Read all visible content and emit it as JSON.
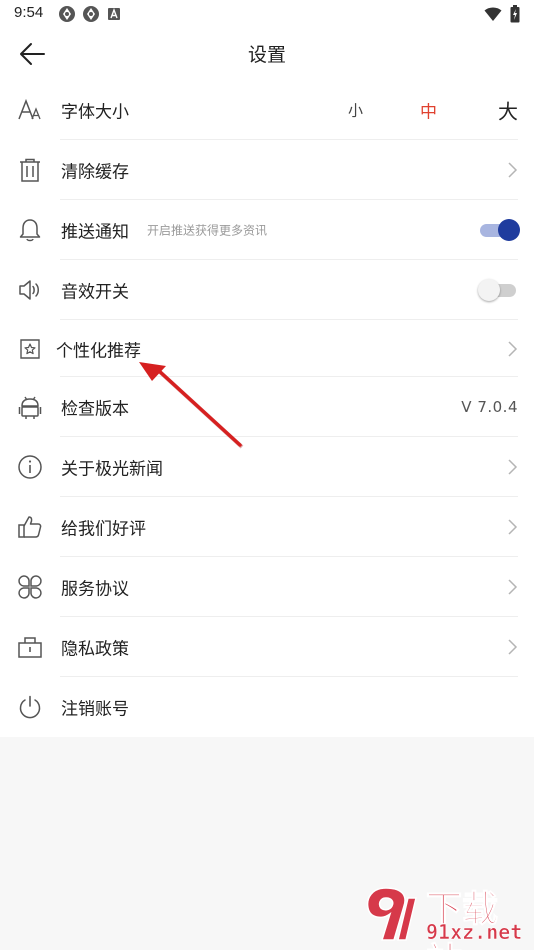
{
  "status_bar": {
    "time": "9:54",
    "left_icons": [
      "app-notification-icon",
      "app-notification-icon",
      "a-notification-icon"
    ],
    "right_icons": [
      "wifi-icon",
      "battery-charging-icon"
    ]
  },
  "header": {
    "title": "设置",
    "back_icon": "arrow-left-icon"
  },
  "settings": {
    "font_size": {
      "label": "字体大小",
      "icon": "font-size-icon",
      "options": [
        "小",
        "中",
        "大"
      ],
      "selected": "中"
    },
    "clear_cache": {
      "label": "清除缓存",
      "icon": "trash-icon"
    },
    "push_notification": {
      "label": "推送通知",
      "subtitle": "开启推送获得更多资讯",
      "icon": "bell-icon",
      "enabled": true
    },
    "sound_effects": {
      "label": "音效开关",
      "icon": "speaker-icon",
      "enabled": false
    },
    "personalized": {
      "label": "个性化推荐",
      "icon": "star-bookmark-icon"
    },
    "check_version": {
      "label": "检查版本",
      "icon": "android-icon",
      "version": "V 7.0.4"
    },
    "about": {
      "label": "关于极光新闻",
      "icon": "info-icon"
    },
    "rate_us": {
      "label": "给我们好评",
      "icon": "thumbs-up-icon"
    },
    "service_agreement": {
      "label": "服务协议",
      "icon": "grid-clover-icon"
    },
    "privacy_policy": {
      "label": "隐私政策",
      "icon": "lock-box-icon"
    },
    "deactivate": {
      "label": "注销账号",
      "icon": "power-icon"
    }
  },
  "watermark": {
    "logo_text": "下载站",
    "url": "91xz.net"
  },
  "colors": {
    "accent_selected": "#e0412f",
    "toggle_on_knob": "#1f3c9e",
    "toggle_on_track": "#a8b5e0",
    "annotation_arrow": "#d62020"
  }
}
